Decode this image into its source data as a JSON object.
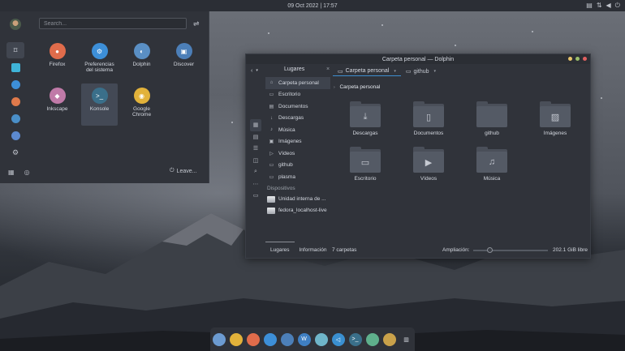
{
  "top_panel": {
    "datetime": "09 Oct 2022 | 17:57"
  },
  "launcher": {
    "search_placeholder": "Search...",
    "apps": [
      {
        "label": "Firefox",
        "icon": "firefox-icon",
        "color": "#e06c4b"
      },
      {
        "label": "Preferencias del sistema",
        "icon": "settings-icon",
        "color": "#3d8fd8"
      },
      {
        "label": "Dolphin",
        "icon": "dolphin-icon",
        "color": "#5a8fc4"
      },
      {
        "label": "Discover",
        "icon": "discover-icon",
        "color": "#4c7fb8"
      },
      {
        "label": "Inkscape",
        "icon": "inkscape-icon",
        "color": "#c07aa8"
      },
      {
        "label": "Konsole",
        "icon": "konsole-icon",
        "color": "#3a6f8a"
      },
      {
        "label": "Google Chrome",
        "icon": "chrome-icon",
        "color": "#e2b23a"
      }
    ],
    "leave_label": "Leave..."
  },
  "dolphin": {
    "title": "Carpeta personal — Dolphin",
    "places_title": "Lugares",
    "places": [
      {
        "label": "Carpeta personal",
        "icon": "⌂"
      },
      {
        "label": "Escritorio",
        "icon": "▭"
      },
      {
        "label": "Documentos",
        "icon": "▤"
      },
      {
        "label": "Descargas",
        "icon": "↓"
      },
      {
        "label": "Música",
        "icon": "♪"
      },
      {
        "label": "Imágenes",
        "icon": "▣"
      },
      {
        "label": "Vídeos",
        "icon": "▷"
      },
      {
        "label": "github",
        "icon": "▭"
      },
      {
        "label": "plasma",
        "icon": "▭"
      }
    ],
    "devices_label": "Dispositivos",
    "devices": [
      {
        "label": "Unidad interna de ..."
      },
      {
        "label": "fedora_localhost-live"
      }
    ],
    "tabs": [
      {
        "label": "Carpeta personal"
      },
      {
        "label": "github"
      }
    ],
    "breadcrumb": "Carpeta personal",
    "folders": [
      {
        "label": "Descargas",
        "glyph": "⤓"
      },
      {
        "label": "Documentos",
        "glyph": "▯"
      },
      {
        "label": "github",
        "glyph": ""
      },
      {
        "label": "Imágenes",
        "glyph": "▨"
      },
      {
        "label": "Escritorio",
        "glyph": "▭"
      },
      {
        "label": "Vídeos",
        "glyph": "▶"
      },
      {
        "label": "Música",
        "glyph": "♫"
      }
    ],
    "bottom_tabs": [
      "Lugares",
      "Información"
    ],
    "status_count": "7 carpetas",
    "zoom_label": "Ampliación:",
    "zoom_level": 0.2,
    "free_space": "202.1 GiB libre"
  },
  "dock": {
    "items": [
      {
        "icon": "dolphin-icon",
        "color": "#6c9bd1"
      },
      {
        "icon": "chrome-icon",
        "color": "#e2b23a"
      },
      {
        "icon": "firefox-icon",
        "color": "#e06c4b"
      },
      {
        "icon": "settings-icon",
        "color": "#3d8fd8"
      },
      {
        "icon": "discover-icon",
        "color": "#4c7fb8"
      },
      {
        "icon": "libreoffice-writer-icon",
        "color": "#3f7fc2"
      },
      {
        "icon": "image-viewer-icon",
        "color": "#6fb5c9"
      },
      {
        "icon": "vscode-icon",
        "color": "#3a8fd0"
      },
      {
        "icon": "konsole-icon",
        "color": "#3a6f8a"
      },
      {
        "icon": "color-picker-icon",
        "color": "#5fb08c"
      },
      {
        "icon": "plasma-icon",
        "color": "#c9a14a"
      },
      {
        "icon": "trash-icon",
        "color": "#5a5f68"
      }
    ]
  }
}
